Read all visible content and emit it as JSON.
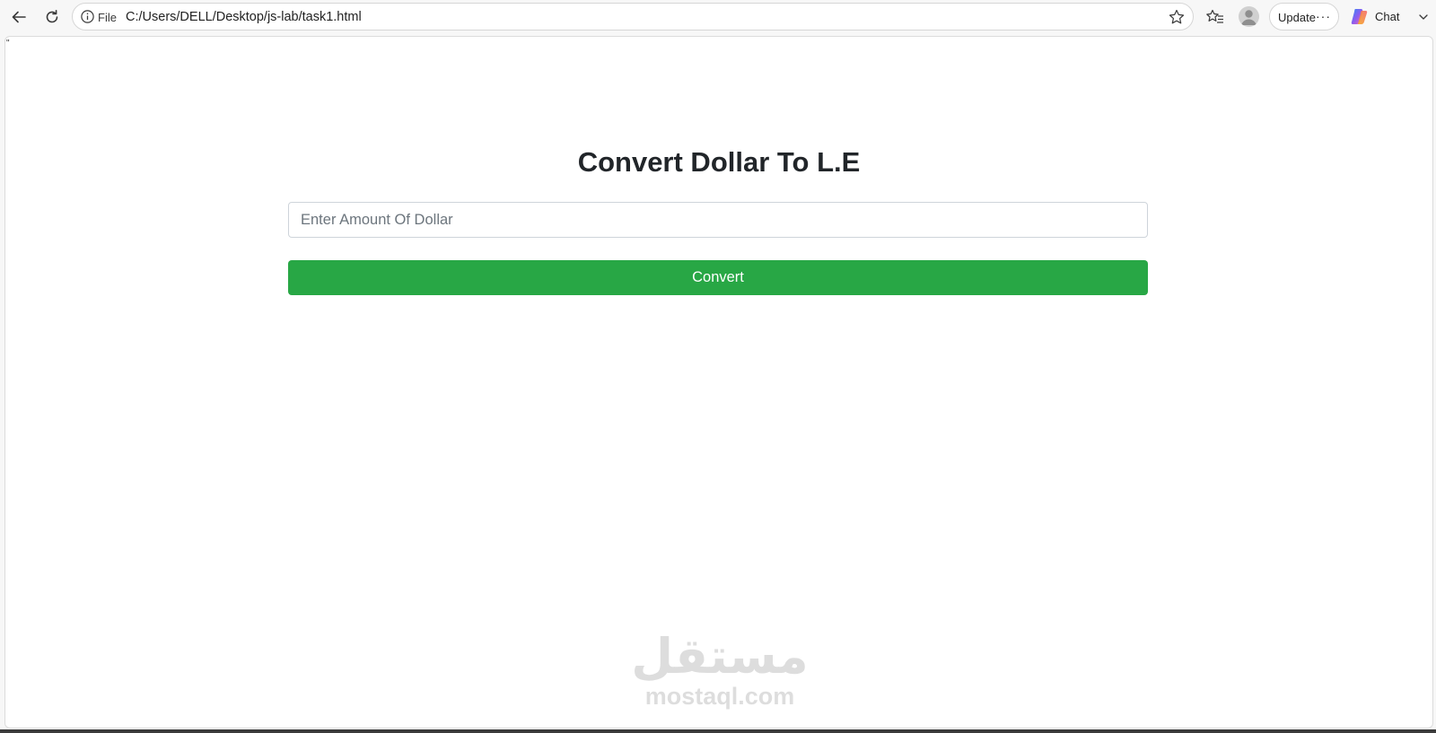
{
  "browser": {
    "url_scheme_label": "File",
    "url": "C:/Users/DELL/Desktop/js-lab/task1.html",
    "update_label": "Update",
    "more_label": "···",
    "chat_label": "Chat",
    "icons": [
      "back-arrow-icon",
      "refresh-icon",
      "info-icon",
      "star-icon",
      "favorites-icon",
      "profile-avatar-icon",
      "more-icon",
      "copilot-icon",
      "chevron-down-icon"
    ]
  },
  "page": {
    "stray_mark": "\"",
    "title": "Convert Dollar To L.E",
    "amount_input": {
      "placeholder": "Enter Amount Of Dollar",
      "value": ""
    },
    "convert_button_label": "Convert"
  },
  "watermark": {
    "arabic": "مستقل",
    "latin": "mostaql.com"
  },
  "colors": {
    "button_bg": "#28a745",
    "button_text": "#ffffff",
    "title_text": "#212529",
    "input_border": "#ced4da"
  }
}
